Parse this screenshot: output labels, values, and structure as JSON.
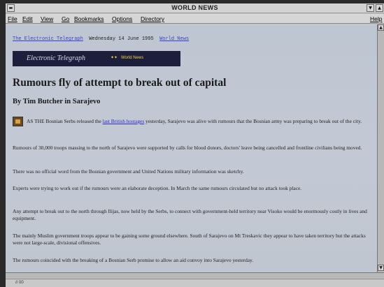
{
  "window": {
    "title": "WORLD NEWS"
  },
  "menu": {
    "items": [
      "File",
      "Edit",
      "View",
      "Go",
      "Bookmarks",
      "Options",
      "Directory"
    ],
    "help": "Help"
  },
  "page": {
    "masthead_link": "The Electronic Telegraph",
    "date": "Wednesday 14 June 1995",
    "section_link": "World News",
    "banner_brand": "Electronic Telegraph",
    "banner_section": "World News",
    "headline": "Rumours fly of attempt to break out of capital",
    "byline": "By Tim Butcher in Sarajevo",
    "p1_before": "AS THE Bosnian Serbs released the ",
    "p1_link": "last British hostages",
    "p1_after": " yesterday, Sarajevo was alive with rumours that the Bosnian army was preparing to break out of the city.",
    "p2": "Rumours of 30,000 troops massing to the north of Sarajevo were supported by calls for blood donors, doctors' leave being cancelled and frontline civilians being moved.",
    "p3": "There was no official word from the Bosnian government and United Nations military information was sketchy.",
    "p4": "Experts were trying to work out if the rumours were an elaborate deception. In March the same rumours circulated but no attack took place.",
    "p5": "Any attempt to break out to the north through Ilijas, now held by the Serbs, to connect with government-held territory near Visoko would be enormously costly in lives and equipment.",
    "p6": "The mainly Muslim government troops appear to be gaining some ground elsewhere. South of Sarajevo on Mt Treskavic they appear to have taken territory but the attacks were not large-scale, divisional offensives.",
    "p7": "The rumours coincided with the breaking of a Bosnian Serb promise to allow an aid convoy into Sarajevo yesterday."
  },
  "status": {
    "text": "// 00"
  }
}
